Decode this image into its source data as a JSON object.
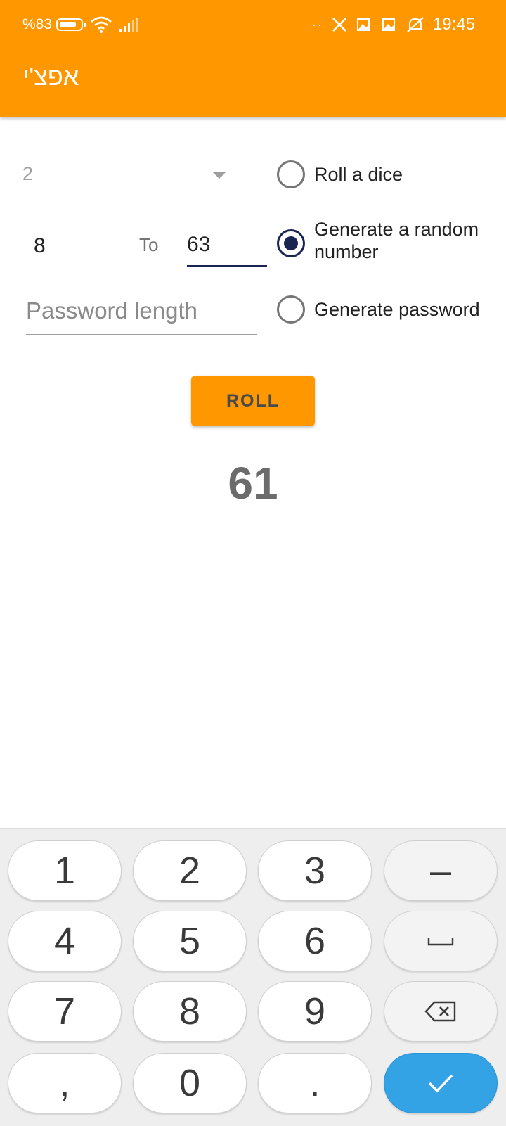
{
  "status_bar": {
    "battery_percent": "%83",
    "time": "19:45",
    "dots": "··",
    "icons": [
      "battery-icon",
      "wifi-icon",
      "signal-icon",
      "x-app-icon",
      "notification-icon",
      "notification-icon",
      "mute-icon"
    ]
  },
  "app_bar": {
    "title": "אפצ'י"
  },
  "dice": {
    "selected_value": "2"
  },
  "range": {
    "from_value": "8",
    "to_label": "To",
    "to_value": "63"
  },
  "password": {
    "placeholder": "Password length"
  },
  "options": [
    {
      "label": "Roll a dice",
      "checked": false
    },
    {
      "label": "Generate a random number",
      "checked": true
    },
    {
      "label": "Generate password",
      "checked": false
    }
  ],
  "roll_button": {
    "label": "ROLL"
  },
  "result": {
    "value": "61"
  },
  "keyboard": {
    "keys": [
      "1",
      "2",
      "3",
      "–",
      "4",
      "5",
      "6",
      "7",
      "8",
      "9",
      ",",
      "0",
      "."
    ],
    "special": [
      "space-icon",
      "backspace-icon",
      "check-icon"
    ]
  },
  "colors": {
    "accent": "#ff9800",
    "primary_dark": "#1a2551",
    "keyboard_done": "#33a3e6"
  }
}
